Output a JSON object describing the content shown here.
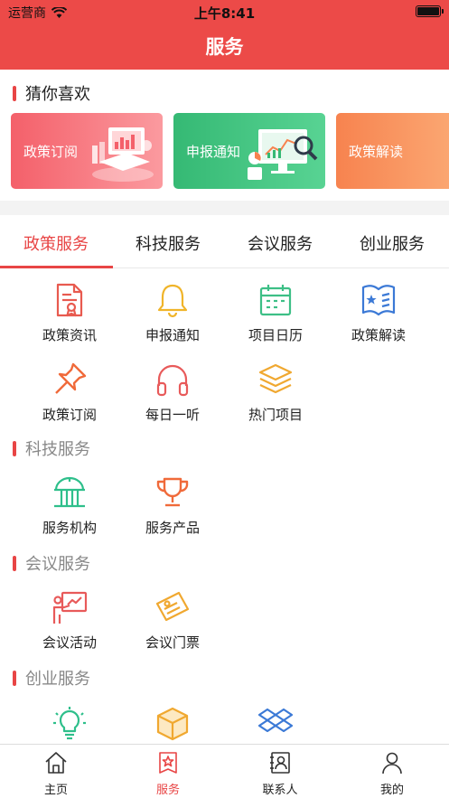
{
  "status_bar": {
    "carrier": "运营商",
    "time": "上午8:41"
  },
  "header": {
    "title": "服务"
  },
  "recommend": {
    "title": "猜你喜欢",
    "cards": [
      {
        "label": "政策订阅"
      },
      {
        "label": "申报通知"
      },
      {
        "label": "政策解读"
      }
    ]
  },
  "tabs": [
    {
      "label": "政策服务",
      "active": true
    },
    {
      "label": "科技服务",
      "active": false
    },
    {
      "label": "会议服务",
      "active": false
    },
    {
      "label": "创业服务",
      "active": false
    }
  ],
  "policy": {
    "items": [
      {
        "label": "政策资讯",
        "icon": "document-badge-icon"
      },
      {
        "label": "申报通知",
        "icon": "bell-icon"
      },
      {
        "label": "项目日历",
        "icon": "calendar-icon"
      },
      {
        "label": "政策解读",
        "icon": "book-star-icon"
      },
      {
        "label": "政策订阅",
        "icon": "pushpin-icon"
      },
      {
        "label": "每日一听",
        "icon": "headphones-icon"
      },
      {
        "label": "热门项目",
        "icon": "layers-icon"
      }
    ]
  },
  "tech": {
    "title": "科技服务",
    "items": [
      {
        "label": "服务机构",
        "icon": "institution-icon"
      },
      {
        "label": "服务产品",
        "icon": "trophy-icon"
      }
    ]
  },
  "meeting": {
    "title": "会议服务",
    "items": [
      {
        "label": "会议活动",
        "icon": "presentation-icon"
      },
      {
        "label": "会议门票",
        "icon": "ticket-icon"
      }
    ]
  },
  "startup": {
    "title": "创业服务",
    "items": [
      {
        "icon": "lightbulb-icon"
      },
      {
        "icon": "box-icon"
      },
      {
        "icon": "dropbox-icon"
      }
    ]
  },
  "tabbar": [
    {
      "label": "主页",
      "icon": "home-icon",
      "active": false
    },
    {
      "label": "服务",
      "icon": "service-star-icon",
      "active": true
    },
    {
      "label": "联系人",
      "icon": "contacts-icon",
      "active": false
    },
    {
      "label": "我的",
      "icon": "user-icon",
      "active": false
    }
  ],
  "colors": {
    "accent": "#e84545",
    "header": "#ec4a48",
    "card_red": "#f4606a",
    "card_green": "#35b974",
    "card_orange": "#f7834f"
  }
}
